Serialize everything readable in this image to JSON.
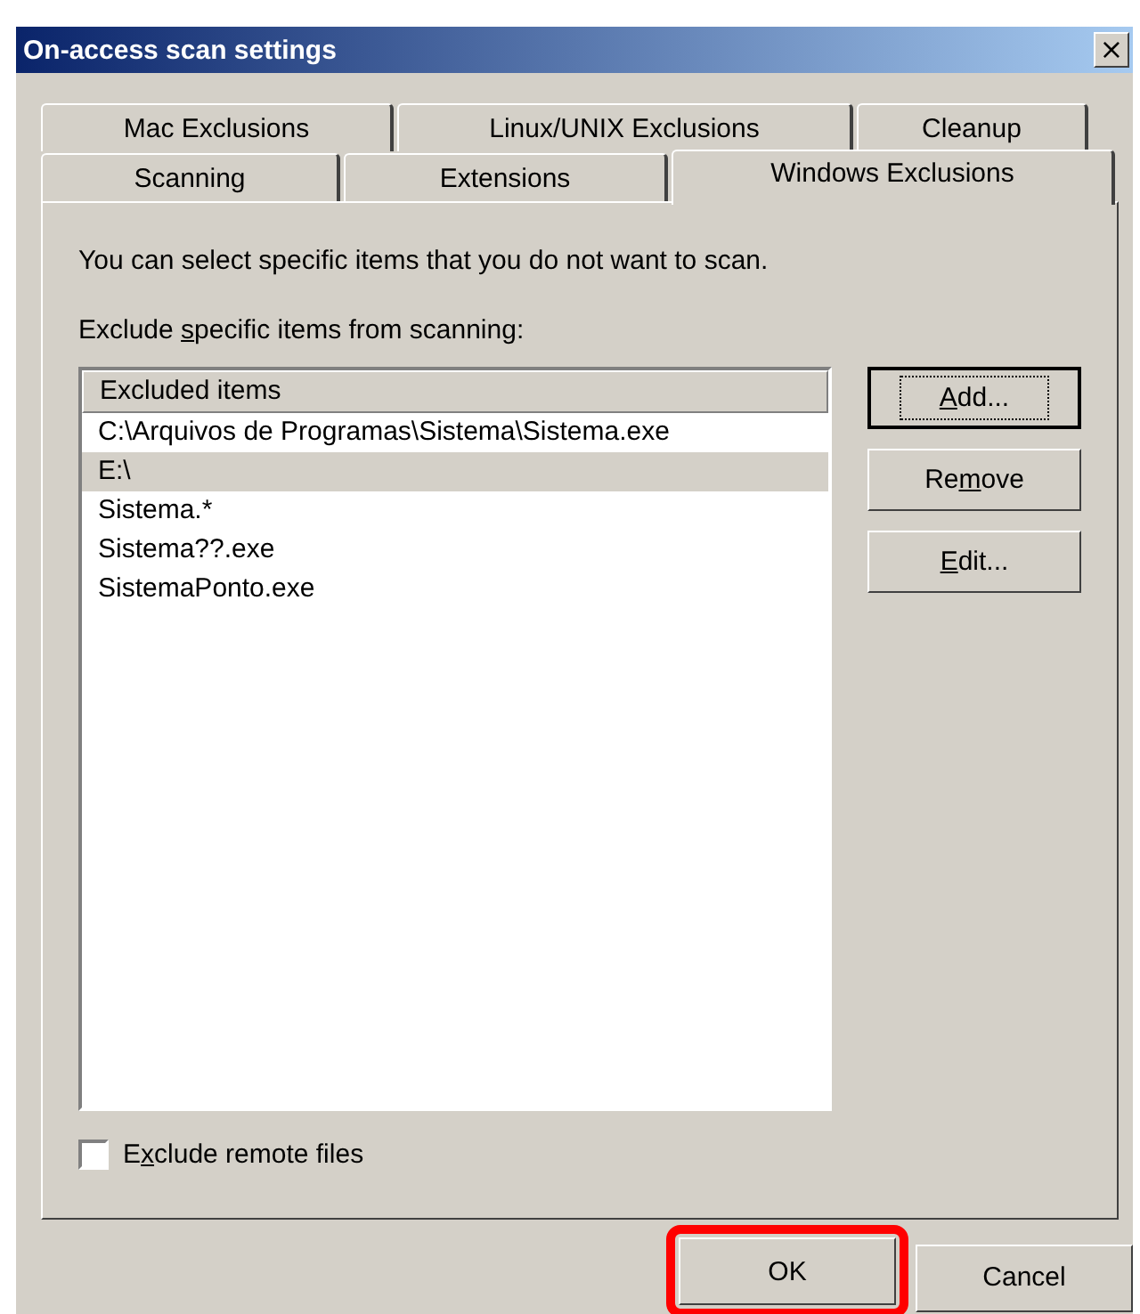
{
  "window": {
    "title": "On-access scan settings",
    "close": "×"
  },
  "tab_rows": [
    [
      {
        "label": "Mac Exclusions",
        "selected": false
      },
      {
        "label": "Linux/UNIX Exclusions",
        "selected": false
      },
      {
        "label": "Cleanup",
        "selected": false
      }
    ],
    [
      {
        "label": "Scanning",
        "selected": false
      },
      {
        "label": "Extensions",
        "selected": false
      },
      {
        "label": "Windows Exclusions",
        "selected": true
      }
    ]
  ],
  "intro": "You can select specific items that you do not want to scan.",
  "list_label": {
    "before": "Exclude ",
    "key": "s",
    "after": "pecific items from scanning:"
  },
  "list": {
    "header": "Excluded items",
    "rows": [
      {
        "text": "C:\\Arquivos de Programas\\Sistema\\Sistema.exe",
        "selected": false
      },
      {
        "text": "E:\\",
        "selected": true
      },
      {
        "text": "Sistema.*",
        "selected": false
      },
      {
        "text": "Sistema??.exe",
        "selected": false
      },
      {
        "text": "SistemaPonto.exe",
        "selected": false
      }
    ]
  },
  "side_buttons": [
    {
      "key": "A",
      "after": "dd...",
      "default": true
    },
    {
      "before": "Re",
      "key": "m",
      "after": "ove",
      "default": false
    },
    {
      "key": "E",
      "after": "dit...",
      "default": false
    }
  ],
  "remote_checkbox": {
    "before": "E",
    "key": "x",
    "after": "clude remote files",
    "checked": false
  },
  "footer_buttons": [
    {
      "label": "OK",
      "highlighted": true
    },
    {
      "label": "Cancel",
      "highlighted": false
    }
  ]
}
